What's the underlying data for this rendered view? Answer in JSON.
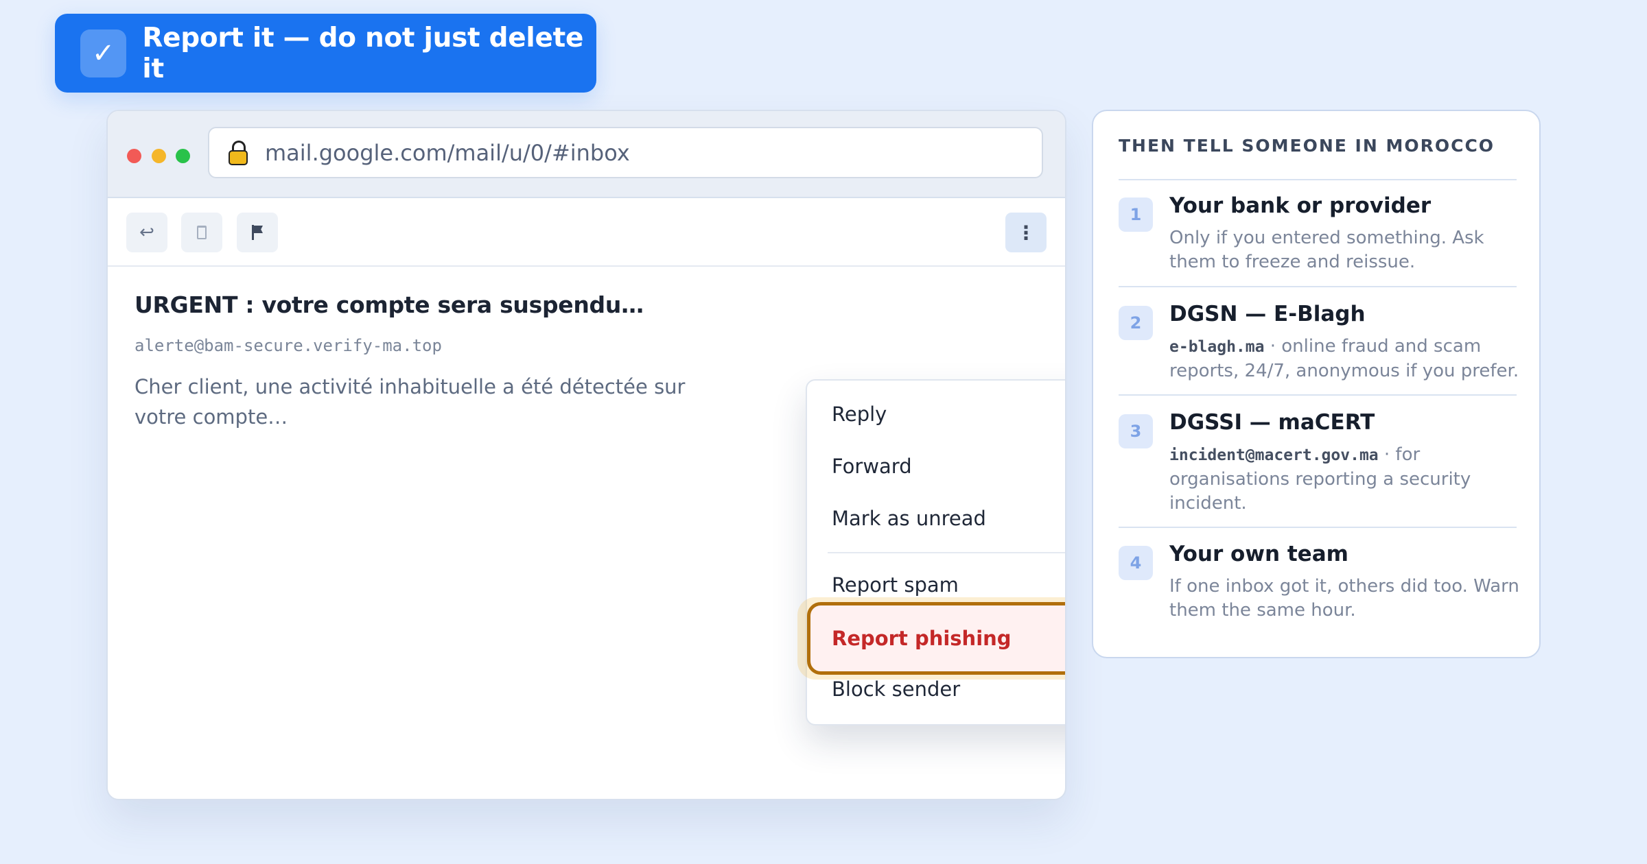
{
  "banner": {
    "icon": "checkmark-icon",
    "check_glyph": "✓",
    "title": "Report it — do not just delete it"
  },
  "browser": {
    "window_dots": [
      "#f25a56",
      "#f5b62a",
      "#29c24a"
    ],
    "url": "mail.google.com/mail/u/0/#inbox",
    "toolbar": {
      "reply_glyph": "↩",
      "more_glyph": "⋮"
    },
    "email": {
      "subject": "URGENT : votre compte sera suspendu…",
      "sender": "alerte@bam-secure.verify-ma.top",
      "preview": "Cher client, une activité inhabituelle a été détectée sur votre compte…"
    },
    "menu": {
      "reply": "Reply",
      "forward": "Forward",
      "mark_unread": "Mark as unread",
      "report_spam": "Report spam",
      "report_phishing": "Report phishing",
      "block_sender": "Block sender",
      "highlighted": "Report phishing"
    }
  },
  "panel": {
    "heading": "THEN TELL SOMEONE IN MOROCCO",
    "items": [
      {
        "num": "1",
        "title": "Your bank or provider",
        "desc": "Only if you entered something. Ask them to freeze and reissue."
      },
      {
        "num": "2",
        "title": "DGSN — E-Blagh",
        "code": "e-blagh.ma",
        "desc": " · online fraud and scam reports, 24/7, anonymous if you prefer."
      },
      {
        "num": "3",
        "title": "DGSSI — maCERT",
        "code": "incident@macert.gov.ma",
        "desc": " · for organisations reporting a security incident."
      },
      {
        "num": "4",
        "title": "Your own team",
        "desc": "If one inbox got it, others did too. Warn them the same hour."
      }
    ]
  },
  "colors": {
    "accent": "#1a73f0",
    "danger": "#c42828",
    "highlight_border": "#b16f0c",
    "background": "#e6effd"
  }
}
